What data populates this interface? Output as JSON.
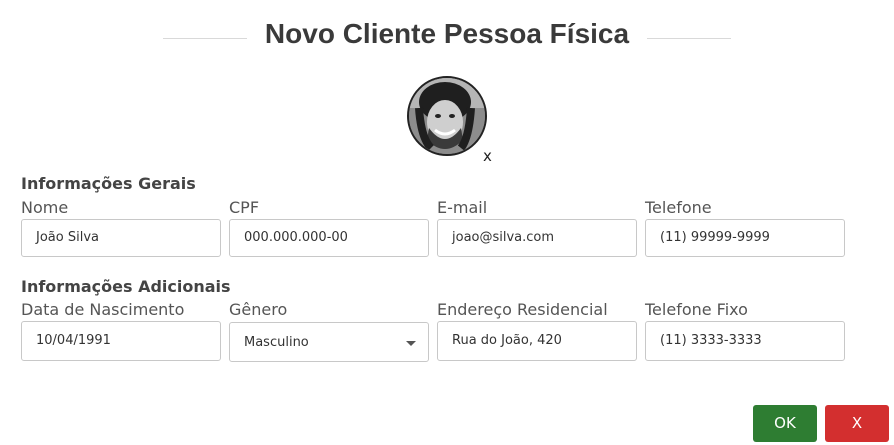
{
  "page": {
    "title": "Novo Cliente Pessoa Física"
  },
  "avatar": {
    "remove_label": "x"
  },
  "general": {
    "section_title": "Informações Gerais",
    "fields": [
      {
        "label": "Nome",
        "value": "João Silva"
      },
      {
        "label": "CPF",
        "value": "000.000.000-00"
      },
      {
        "label": "E-mail",
        "value": "joao@silva.com"
      },
      {
        "label": "Telefone",
        "value": "(11) 99999-9999"
      }
    ]
  },
  "additional": {
    "section_title": "Informações Adicionais",
    "fields": [
      {
        "label": "Data de Nascimento",
        "value": "10/04/1991"
      },
      {
        "label": "Gênero",
        "value": "Masculino"
      },
      {
        "label": "Endereço Residencial",
        "value": "Rua do João, 420"
      },
      {
        "label": "Telefone Fixo",
        "value": "(11) 3333-3333"
      }
    ]
  },
  "actions": {
    "ok_label": "OK",
    "cancel_label": "X",
    "ok_color": "#2e7d32",
    "cancel_color": "#d32f2f"
  }
}
